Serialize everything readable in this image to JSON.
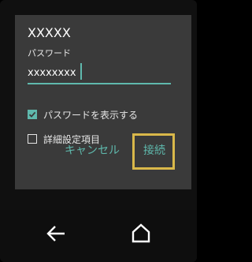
{
  "dialog": {
    "ssid": "XXXXX",
    "password_label": "パスワード",
    "password_value": "xxxxxxxx",
    "show_password": {
      "label": "パスワードを表示する",
      "checked": true
    },
    "advanced": {
      "label": "詳細設定項目",
      "checked": false
    },
    "cancel_label": "キャンセル",
    "connect_label": "接続"
  },
  "nav": {
    "back_icon": "back-arrow-icon",
    "home_icon": "home-icon"
  },
  "colors": {
    "accent": "#5fb9ad",
    "highlight": "#d9b84a",
    "dialog_bg": "#3a3a3a"
  }
}
